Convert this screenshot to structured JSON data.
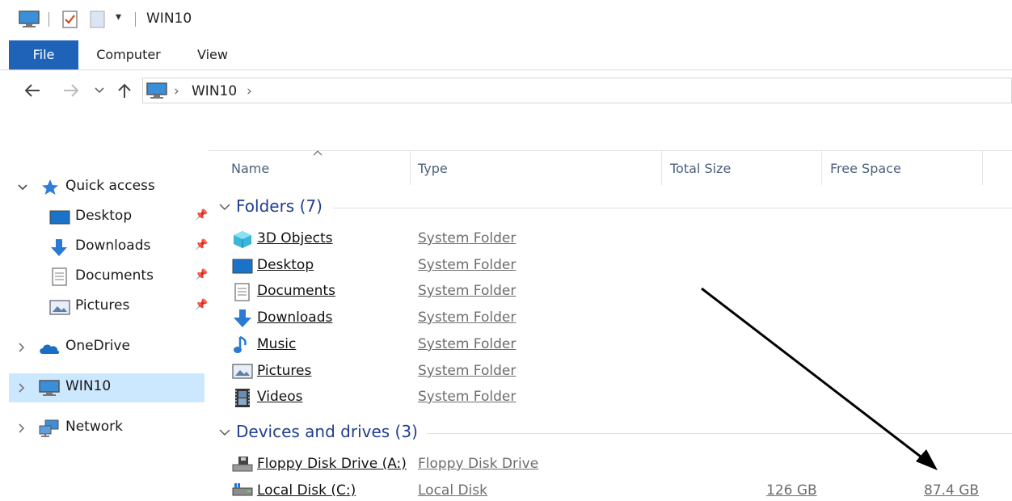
{
  "titlebar": {
    "title": "WIN10",
    "dropdown_glyph": "▾"
  },
  "ribbon": {
    "tabs": [
      "File",
      "Computer",
      "View"
    ]
  },
  "address": {
    "separator": "›",
    "crumbs": [
      "WIN10"
    ]
  },
  "nav": {
    "quick_access": "Quick access",
    "quick_items": [
      "Desktop",
      "Downloads",
      "Documents",
      "Pictures"
    ],
    "onedrive": "OneDrive",
    "win10": "WIN10",
    "network": "Network"
  },
  "columns": [
    "Name",
    "Type",
    "Total Size",
    "Free Space"
  ],
  "folders": {
    "heading": "Folders (7)",
    "items": [
      {
        "name": "3D Objects",
        "type": "System Folder",
        "icon": "3d-objects-icon"
      },
      {
        "name": "Desktop",
        "type": "System Folder",
        "icon": "desktop-icon"
      },
      {
        "name": "Documents",
        "type": "System Folder",
        "icon": "documents-icon"
      },
      {
        "name": "Downloads",
        "type": "System Folder",
        "icon": "downloads-icon"
      },
      {
        "name": "Music",
        "type": "System Folder",
        "icon": "music-icon"
      },
      {
        "name": "Pictures",
        "type": "System Folder",
        "icon": "pictures-icon"
      },
      {
        "name": "Videos",
        "type": "System Folder",
        "icon": "videos-icon"
      }
    ]
  },
  "devices": {
    "heading": "Devices and drives (3)",
    "items": [
      {
        "name": "Floppy Disk Drive (A:)",
        "type": "Floppy Disk Drive",
        "total": "",
        "free": "",
        "icon": "floppy-drive-icon"
      },
      {
        "name": "Local Disk (C:)",
        "type": "Local Disk",
        "total": "126 GB",
        "free": "87.4 GB",
        "icon": "local-disk-icon"
      }
    ]
  },
  "colors": {
    "accent": "#1f63b8",
    "selection": "#cce8ff",
    "group_heading": "#1f3f91"
  }
}
